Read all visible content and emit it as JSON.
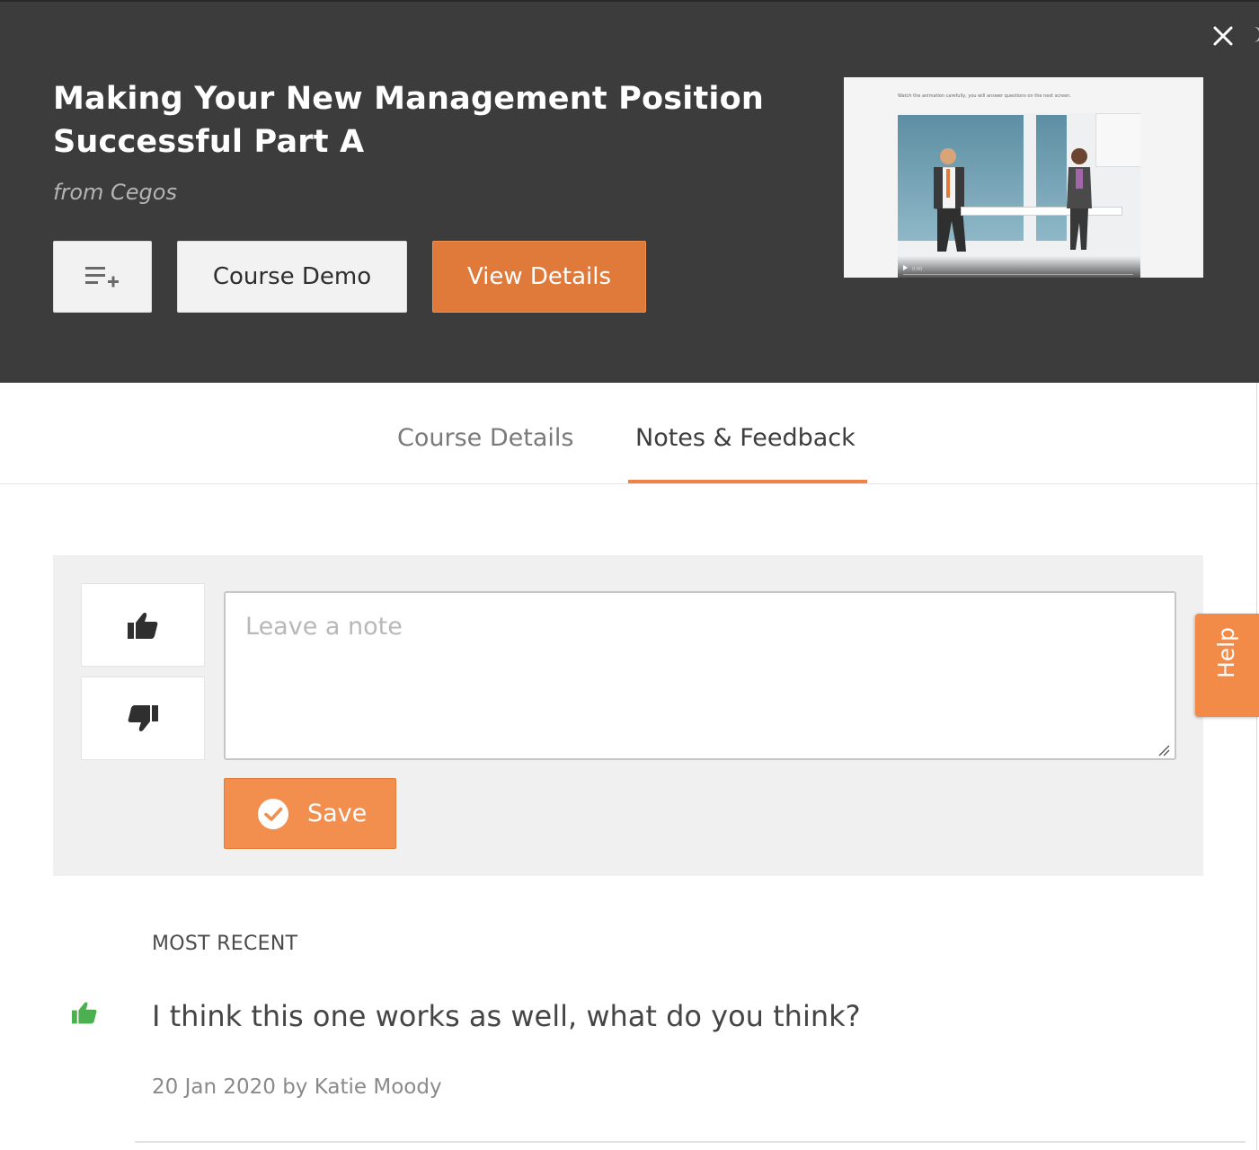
{
  "course": {
    "title": "Making Your New Management Position Successful Part A",
    "source": "from Cegos"
  },
  "actions": {
    "add_to_playlist_icon": "playlist-add-icon",
    "demo_label": "Course Demo",
    "details_label": "View Details"
  },
  "preview": {
    "caption": "Watch the animation carefully, you will answer questions on the next screen.",
    "time": "0:00"
  },
  "tabs": [
    {
      "label": "Course Details",
      "active": false
    },
    {
      "label": "Notes & Feedback",
      "active": true
    }
  ],
  "note_form": {
    "placeholder": "Leave a note",
    "value": "",
    "save_label": "Save",
    "thumbs_up_icon": "thumbs-up-icon",
    "thumbs_down_icon": "thumbs-down-icon"
  },
  "help": {
    "label": "Help"
  },
  "recent": {
    "heading": "MOST RECENT",
    "items": [
      {
        "sentiment": "positive",
        "text": "I think this one works as well, what do you think?",
        "meta": "20 Jan 2020 by Katie Moody"
      }
    ]
  },
  "colors": {
    "header_bg": "#3c3c3c",
    "accent_orange": "#e07a3a",
    "save_orange": "#f28f4e",
    "positive_green": "#4caf50"
  }
}
